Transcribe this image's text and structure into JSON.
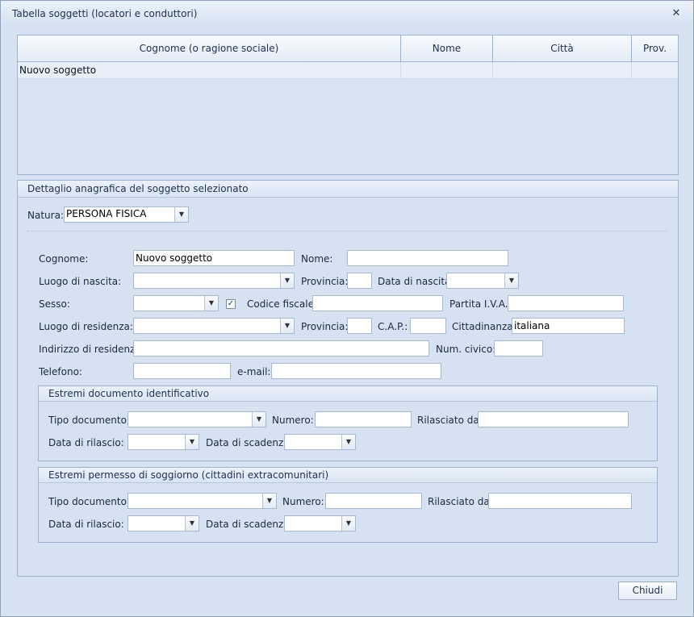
{
  "window": {
    "title": "Tabella soggetti (locatori e conduttori)",
    "close_icon": "✕"
  },
  "grid": {
    "columns": [
      "Cognome (o ragione sociale)",
      "Nome",
      "Città",
      "Prov."
    ],
    "rows": [
      {
        "cognome": "Nuovo soggetto",
        "nome": "",
        "citta": "",
        "prov": ""
      }
    ]
  },
  "detail": {
    "title": "Dettaglio anagrafica del soggetto selezionato",
    "natura_label": "Natura:",
    "natura_value": "PERSONA FISICA",
    "cognome_label": "Cognome:",
    "cognome_value": "Nuovo soggetto",
    "nome_label": "Nome:",
    "nome_value": "",
    "luogo_nascita_label": "Luogo di nascita:",
    "provincia_label": "Provincia:",
    "data_nascita_label": "Data di nascita:",
    "sesso_label": "Sesso:",
    "codice_fiscale_label": "Codice fiscale:",
    "codice_fiscale_checked": true,
    "partita_iva_label": "Partita I.V.A.:",
    "luogo_residenza_label": "Luogo di residenza:",
    "provincia2_label": "Provincia:",
    "cap_label": "C.A.P.:",
    "cittadinanza_label": "Cittadinanza:",
    "cittadinanza_value": "italiana",
    "indirizzo_label": "Indirizzo di residenza:",
    "num_civico_label": "Num. civico:",
    "telefono_label": "Telefono:",
    "email_label": "e-mail:"
  },
  "doc_id": {
    "title": "Estremi documento identificativo",
    "tipo_label": "Tipo documento:",
    "numero_label": "Numero:",
    "rilasciato_label": "Rilasciato da:",
    "data_rilascio_label": "Data di rilascio:",
    "data_scadenza_label": "Data di scadenza:"
  },
  "permesso": {
    "title": "Estremi permesso di soggiorno (cittadini extracomunitari)",
    "tipo_label": "Tipo documento:",
    "numero_label": "Numero:",
    "rilasciato_label": "Rilasciato da:",
    "data_rilascio_label": "Data di rilascio:",
    "data_scadenza_label": "Data di scadenza:"
  },
  "footer": {
    "chiudi_label": "Chiudi"
  }
}
